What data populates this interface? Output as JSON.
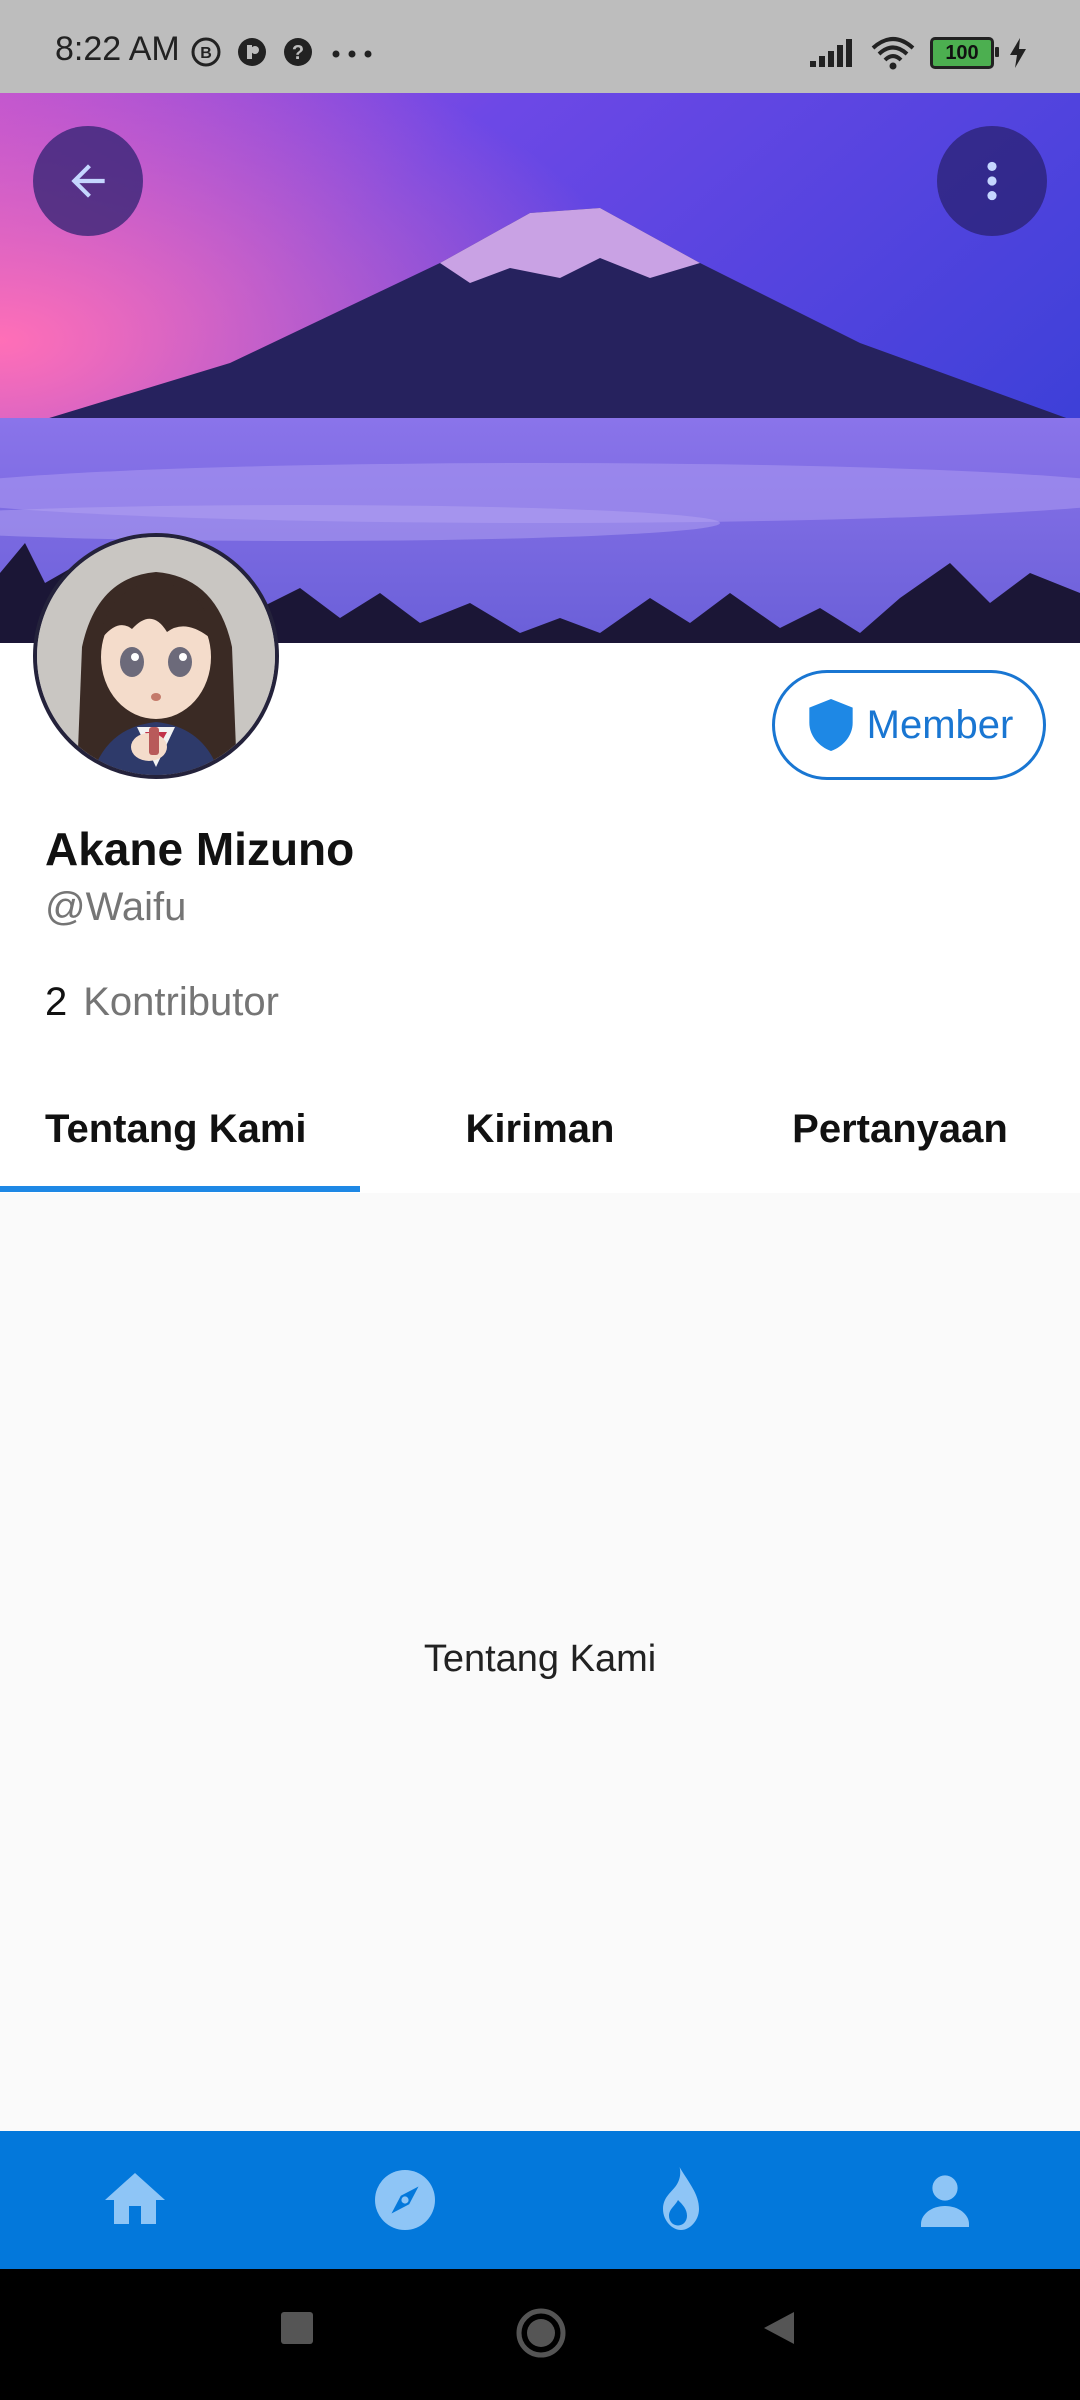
{
  "status_bar": {
    "time": "8:22 AM",
    "battery": "100",
    "icons": [
      "b-badge-icon",
      "record-icon",
      "help-icon",
      "more-dots-icon",
      "signal-icon",
      "wifi-icon",
      "battery-icon",
      "charging-icon"
    ]
  },
  "header": {
    "back_icon": "arrow-back-icon",
    "more_icon": "more-vert-icon"
  },
  "profile": {
    "name": "Akane Mizuno",
    "handle": "@Waifu",
    "contributor_count": "2",
    "contributor_label": "Kontributor",
    "member_label": "Member"
  },
  "tabs": [
    {
      "label": "Tentang Kami",
      "active": true
    },
    {
      "label": "Kiriman",
      "active": false
    },
    {
      "label": "Pertanyaan",
      "active": false
    }
  ],
  "content": {
    "text": "Tentang Kami"
  },
  "bottom_nav": {
    "items": [
      "home-icon",
      "explore-icon",
      "trending-fire-icon",
      "profile-icon"
    ],
    "color": "#0378db"
  },
  "colors": {
    "accent": "#1976d2",
    "tab_indicator": "#1e88e5"
  }
}
